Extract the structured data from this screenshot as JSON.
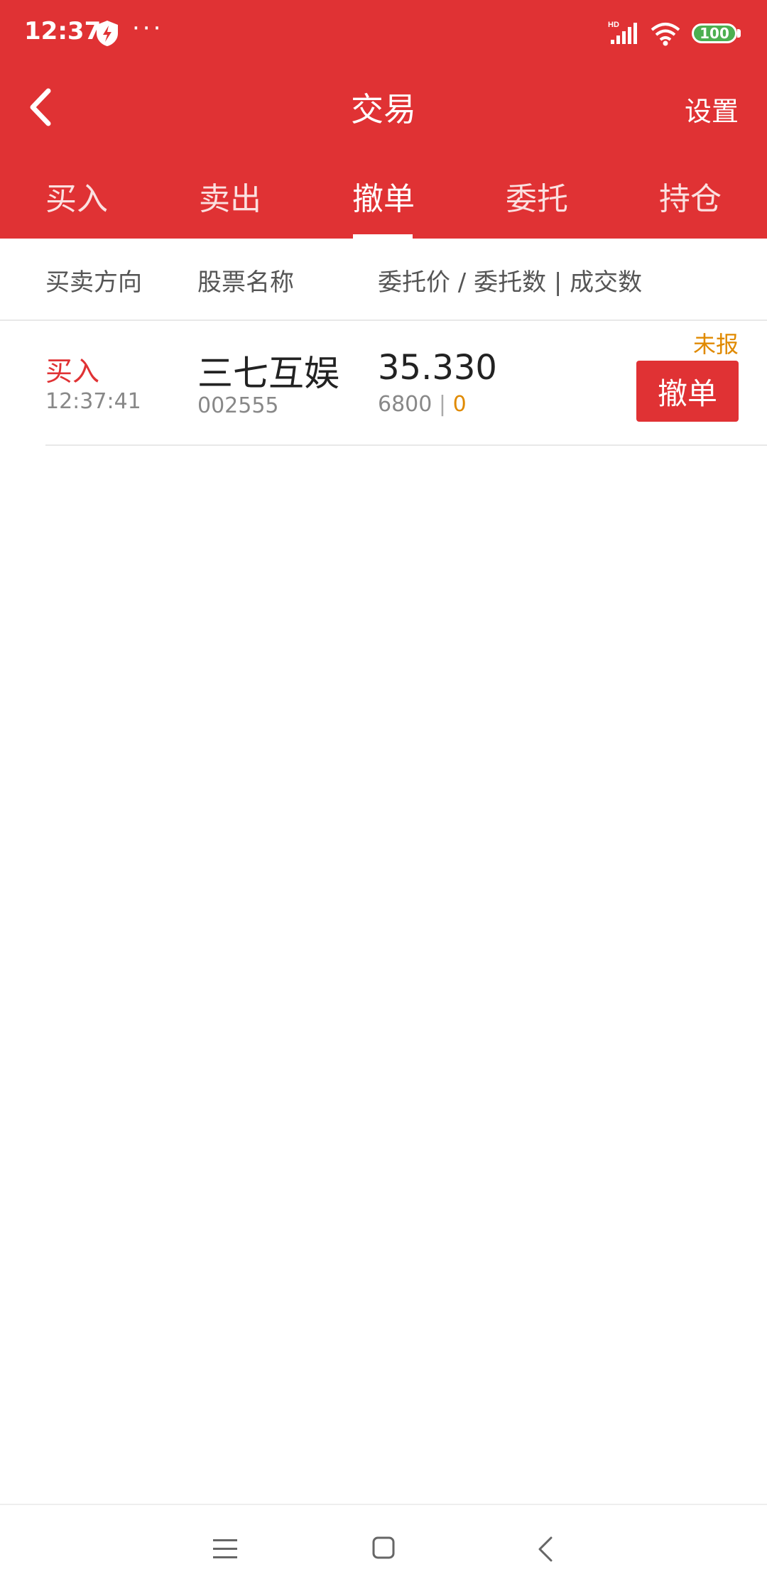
{
  "status_bar": {
    "time": "12:37",
    "icons": [
      "shield-bolt-icon",
      "more-dots-icon",
      "hd-signal-icon",
      "wifi-icon",
      "battery-icon"
    ],
    "dots": "···",
    "battery": "100"
  },
  "navbar": {
    "title": "交易",
    "settings_label": "设置",
    "back_icon": "chevron-left-icon"
  },
  "tabs": [
    {
      "label": "买入"
    },
    {
      "label": "卖出"
    },
    {
      "label": "撤单"
    },
    {
      "label": "委托"
    },
    {
      "label": "持仓"
    }
  ],
  "active_tab": "撤单",
  "columns": {
    "direction": "买卖方向",
    "stock_name": "股票名称",
    "price_qty": "委托价 / 委托数 | 成交数"
  },
  "orders": [
    {
      "direction": "买入",
      "time": "12:37:41",
      "name": "三七互娱",
      "code": "002555",
      "price": "35.330",
      "quantity": "6800",
      "separator": "|",
      "filled": "0",
      "status": "未报",
      "cancel_label": "撤单"
    }
  ],
  "colors": {
    "brand_red": "#e03234",
    "pending_orange": "#e08a00",
    "battery_green": "#4caf50"
  },
  "system_nav": [
    "menu-icon",
    "home-icon",
    "back-icon"
  ]
}
